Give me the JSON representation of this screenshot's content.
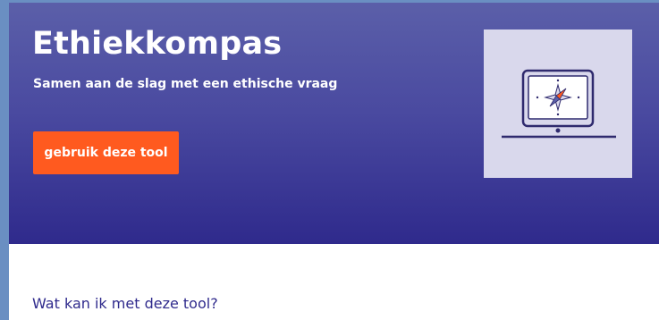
{
  "hero": {
    "title": "Ethiekkompas",
    "subtitle": "Samen aan de slag met een ethische vraag",
    "cta_label": "gebruik deze tool",
    "illustration_icon": "laptop-compass-icon"
  },
  "content": {
    "section_heading": "Wat kan ik met deze tool?"
  },
  "colors": {
    "hero_top": "#5b5fa9",
    "hero_bottom": "#2f2a8c",
    "cta": "#ff5a1f",
    "illustration_bg": "#d9d8ec",
    "heading": "#2f2a8c",
    "frame_border": "#6a8fc2"
  }
}
